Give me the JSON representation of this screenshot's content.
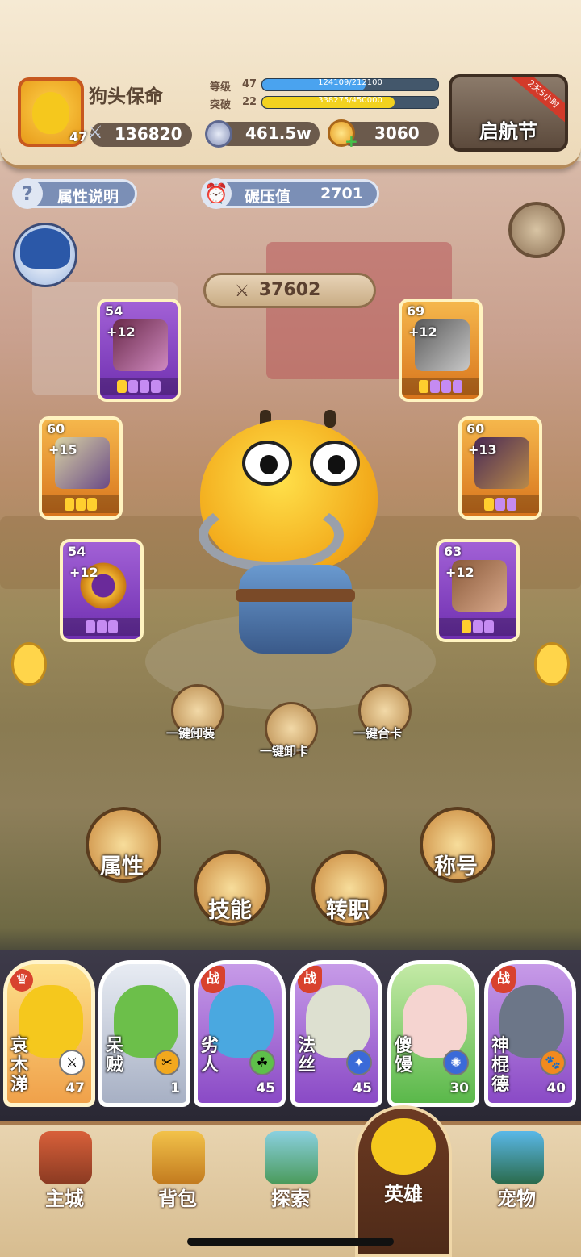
{
  "player": {
    "name": "狗头保命",
    "level": "47",
    "power": "136820"
  },
  "stats": {
    "level_label": "等级",
    "level_value": "47",
    "level_exp": "124109/212100",
    "level_progress": 0.585,
    "break_label": "突破",
    "break_value": "22",
    "break_exp": "338275/450000",
    "break_progress": 0.752
  },
  "currency": {
    "silver": "461.5w",
    "gold": "3060"
  },
  "event": {
    "label": "启航节",
    "countdown": "2天5小时"
  },
  "chips": {
    "attr_info": "属性说明",
    "crush_label": "碾压值",
    "crush_value": "2701"
  },
  "combat_power": "37602",
  "equipment": [
    {
      "slot": "weapon",
      "level": "54",
      "plus": "+12",
      "rarity": "purple",
      "pips": 4
    },
    {
      "slot": "helmet",
      "level": "69",
      "plus": "+12",
      "rarity": "orange",
      "pips": 4
    },
    {
      "slot": "armor",
      "level": "60",
      "plus": "+15",
      "rarity": "orange",
      "pips": 3
    },
    {
      "slot": "cloak",
      "level": "60",
      "plus": "+13",
      "rarity": "orange",
      "pips": 3
    },
    {
      "slot": "ring",
      "level": "54",
      "plus": "+12",
      "rarity": "purple",
      "pips": 3
    },
    {
      "slot": "boots",
      "level": "63",
      "plus": "+12",
      "rarity": "purple",
      "pips": 3
    }
  ],
  "quick_actions": {
    "unequip_gear": "一键卸装",
    "unequip_cards": "一键卸卡",
    "merge_cards": "一键合卡"
  },
  "main_actions": {
    "attributes": "属性",
    "skills": "技能",
    "job_change": "转职",
    "titles": "称号"
  },
  "heroes": [
    {
      "name": "哀木涕",
      "level": "47",
      "tag": "",
      "color": "#f0a14a"
    },
    {
      "name": "呆贼",
      "level": "1",
      "tag": "",
      "color": "#cfd4e0"
    },
    {
      "name": "劣人",
      "level": "45",
      "tag": "战",
      "color": "#b06ad9"
    },
    {
      "name": "法丝",
      "level": "45",
      "tag": "战",
      "color": "#b06ad9"
    },
    {
      "name": "傻馒",
      "level": "30",
      "tag": "",
      "color": "#78c86a"
    },
    {
      "name": "神棍德",
      "level": "40",
      "tag": "战",
      "color": "#b06ad9"
    }
  ],
  "nav": {
    "city": "主城",
    "bag": "背包",
    "explore": "探索",
    "heroes": "英雄",
    "pets": "宠物"
  }
}
